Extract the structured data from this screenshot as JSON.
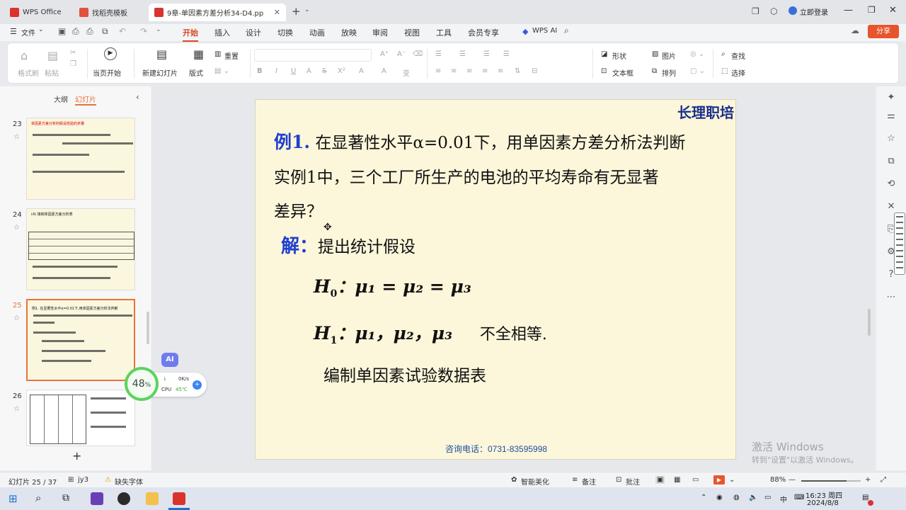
{
  "titlebar": {
    "tabs": [
      {
        "label": "WPS Office"
      },
      {
        "label": "找稻壳模板"
      },
      {
        "label": "9章-单因素方差分析34-D4.pp"
      }
    ],
    "add_tab": "+",
    "login": "立即登录"
  },
  "ribbon": {
    "file_menu": "文件",
    "tabs": [
      "开始",
      "插入",
      "设计",
      "切换",
      "动画",
      "放映",
      "审阅",
      "视图",
      "工具",
      "会员专享"
    ],
    "ai": "WPS AI",
    "share": "分享"
  },
  "toolbar": {
    "format_painter": "格式刷",
    "paste": "粘贴",
    "play_from_current": "当页开始",
    "new_slide": "新建幻灯片",
    "layout": "版式",
    "reset": "重置",
    "shape": "形状",
    "picture": "图片",
    "textbox": "文本框",
    "arrange": "排列",
    "find": "查找",
    "select": "选择"
  },
  "leftpanel": {
    "outline_tab": "大纲",
    "slides_tab": "幻灯片",
    "thumbs": [
      {
        "num": "23",
        "title": "单因素方差分析的假设检验的步骤"
      },
      {
        "num": "24",
        "title": "(4) 填制单因素方差分析表"
      },
      {
        "num": "25",
        "title": "例1. 在显著性水平α=0.01下,用单因素方差分析法判断"
      },
      {
        "num": "26",
        "title": ""
      }
    ],
    "add": "+"
  },
  "slide": {
    "brand": "长理职培",
    "example_label": "例1.",
    "line1": "在显著性水平α=0.01下，用单因素方差分析法判断",
    "line2": "实例1中，三个工厂所生产的电池的平均寿命有无显著",
    "line3": "差异？",
    "solution_label": "解：",
    "solution_text": "提出统计假设",
    "h0_text": "H",
    "h0_sub": "0",
    "h0_rest": "：μ₁ = μ₂ = μ₃",
    "h1_text": "H",
    "h1_sub": "1",
    "h1_rest": "：μ₁，μ₂，μ₃",
    "h1_note": "不全相等.",
    "bottom_text": "编制单因素试验数据表",
    "contact": "咨询电话：0731-83595998"
  },
  "overlay": {
    "ai_badge": "AI",
    "cpu_percent": "48",
    "percent_sign": "%",
    "net": "0K/s",
    "cpu_label": "CPU",
    "cpu_temp": "45℃"
  },
  "watermark": {
    "line1": "激活 Windows",
    "line2": "转到\"设置\"以激活 Windows。"
  },
  "statusbar": {
    "slide_info": "幻灯片 25 / 37",
    "theme": "jy3",
    "missing_font": "缺失字体",
    "beautify": "智能美化",
    "notes": "备注",
    "comments": "批注",
    "zoom": "88%"
  },
  "taskbar": {
    "time": "16:23 周四",
    "date": "2024/8/8",
    "ime": "中"
  },
  "colors": {
    "accent": "#d64a22",
    "slide_bg": "#fcf6da",
    "blue_label": "#1f3fcf",
    "selection": "#e8743b"
  }
}
